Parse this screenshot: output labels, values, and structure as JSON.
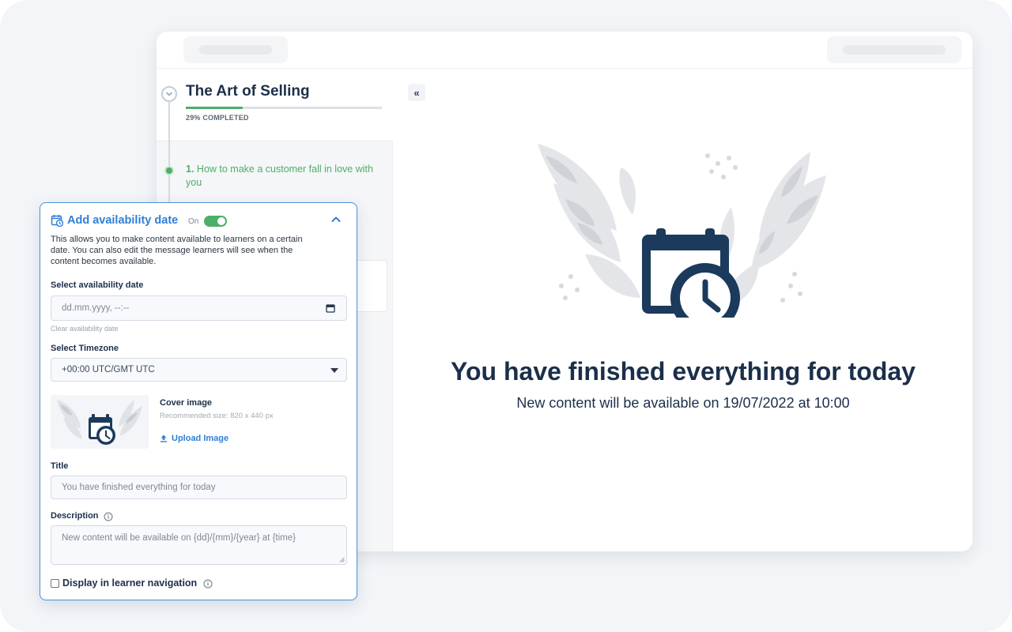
{
  "colors": {
    "accent_blue": "#2f7fd6",
    "success_green": "#4caf68",
    "navy": "#1b2f4a",
    "panel_border": "#4a90d9"
  },
  "course": {
    "title": "The Art of Selling",
    "progress_percent": 29,
    "progress_label": "29% COMPLETED"
  },
  "lesson": {
    "number": "1.",
    "title": "How to make a customer fall in love with you"
  },
  "content": {
    "collapse_icon": "«",
    "title": "You have finished everything for today",
    "subtitle": "New content will be available on 19/07/2022 at 10:00"
  },
  "panel": {
    "header_icon": "calendar-clock-icon",
    "title": "Add availability date",
    "toggle_label": "On",
    "toggle_on": true,
    "description": "This allows you to make content available to learners on a certain date. You can also edit the message learners will see when the content becomes available.",
    "date_label": "Select availability date",
    "date_placeholder": "dd.mm.yyyy, --:--",
    "clear_label": "Clear availability date",
    "timezone_label": "Select Timezone",
    "timezone_value": "+00:00 UTC/GMT UTC",
    "cover_label": "Cover image",
    "cover_hint": "Recommended size: 820 x 440 px",
    "upload_label": "Upload Image",
    "title_label": "Title",
    "title_value": "You have finished everything for today",
    "description_label": "Description",
    "description_value": "New content will be available on {dd}/{mm}/{year} at {time}",
    "display_label": "Display in learner navigation",
    "display_checked": false
  }
}
